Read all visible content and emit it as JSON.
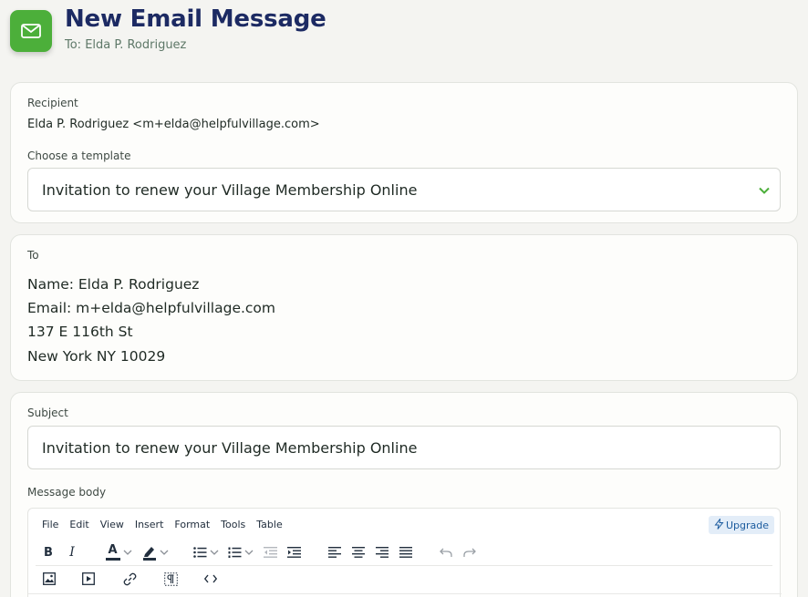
{
  "header": {
    "title": "New Email Message",
    "subtitle": "To: Elda P. Rodriguez",
    "icon": "mail-icon"
  },
  "recipient": {
    "label": "Recipient",
    "value": "Elda P. Rodriguez <m+elda@helpfulvillage.com>"
  },
  "template": {
    "label": "Choose a template",
    "selected": "Invitation to renew your Village Membership Online"
  },
  "to": {
    "label": "To",
    "lines": [
      "Name: Elda P. Rodriguez",
      "Email: m+elda@helpfulvillage.com",
      "137 E 116th St",
      "New York NY 10029"
    ]
  },
  "subject": {
    "label": "Subject",
    "value": "Invitation to renew your Village Membership Online"
  },
  "body": {
    "label": "Message body",
    "menu": [
      "File",
      "Edit",
      "View",
      "Insert",
      "Format",
      "Tools",
      "Table"
    ],
    "upgrade_label": "Upgrade",
    "bold_label": "B",
    "italic_label": "I",
    "text_color_label": "A"
  },
  "colors": {
    "accent_green": "#4caf3a",
    "title_navy": "#1c2a63",
    "upgrade_blue": "#1b5b9e"
  }
}
